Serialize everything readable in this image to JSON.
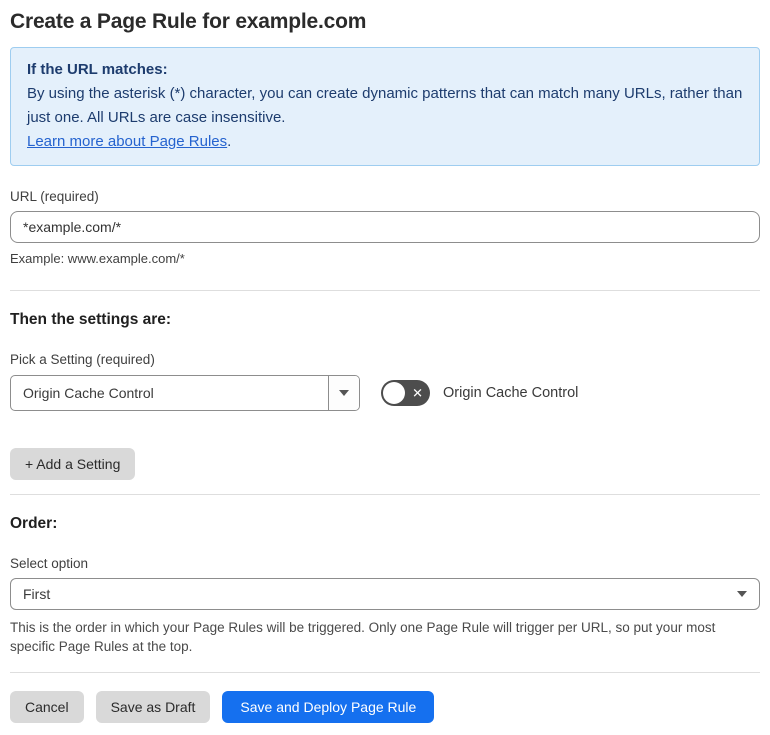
{
  "page": {
    "title": "Create a Page Rule for example.com"
  },
  "info_box": {
    "heading": "If the URL matches:",
    "body": "By using the asterisk (*) character, you can create dynamic patterns that can match many URLs, rather than just one. All URLs are case insensitive.",
    "link_label": "Learn more about Page Rules",
    "link_suffix": "."
  },
  "url_field": {
    "label": "URL (required)",
    "value": "*example.com/*",
    "example": "Example: www.example.com/*"
  },
  "settings_section": {
    "heading": "Then the settings are:",
    "pick_label": "Pick a Setting (required)",
    "selected_setting": "Origin Cache Control",
    "toggle": {
      "state": "off",
      "glyph": "✕",
      "label": "Origin Cache Control"
    },
    "add_button_label": "+ Add a Setting"
  },
  "order_section": {
    "heading": "Order:",
    "label": "Select option",
    "selected_option": "First",
    "help": "This is the order in which your Page Rules will be triggered. Only one Page Rule will trigger per URL, so put your most specific Page Rules at the top."
  },
  "footer": {
    "cancel_label": "Cancel",
    "save_draft_label": "Save as Draft",
    "save_deploy_label": "Save and Deploy Page Rule"
  },
  "colors": {
    "accent_blue": "#1570ef",
    "info_background": "#e4f0fb",
    "info_border": "#9ecdf0",
    "info_text": "#1d3c6e",
    "link_blue": "#2563cf",
    "toggle_off": "#4d4d4d",
    "button_gray": "#d9d9d9"
  }
}
